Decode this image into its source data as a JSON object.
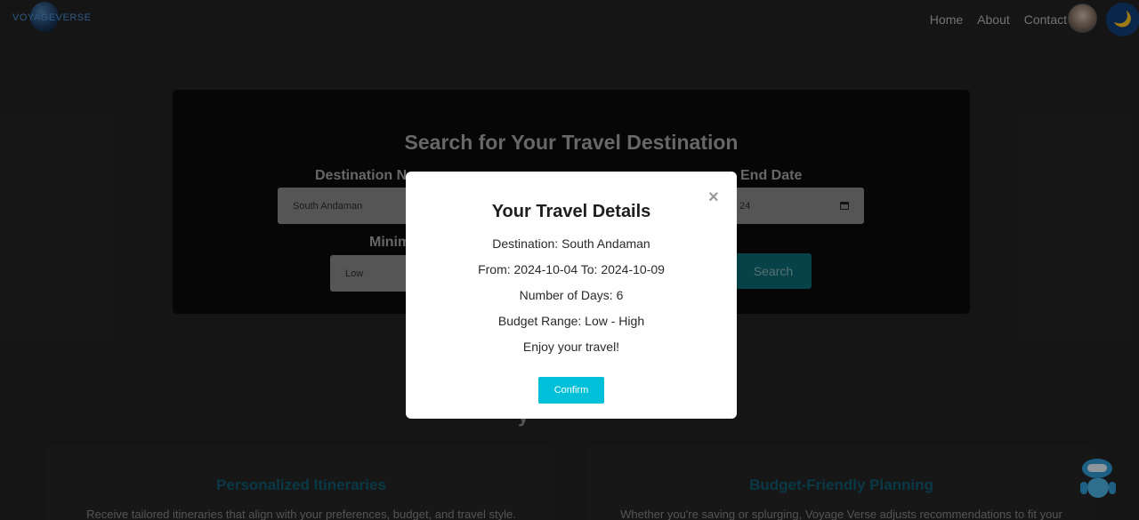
{
  "navbar": {
    "logo_text": "VOYAGEVERSE",
    "links": [
      "Home",
      "About",
      "Contact"
    ],
    "avatar_icon": "user-avatar",
    "theme_icon": "moon-icon",
    "theme_glyph": "🌙"
  },
  "search": {
    "title": "Search for Your Travel Destination",
    "destination_label": "Destination Na",
    "destination_value": "South Andaman",
    "end_date_label": "End Date",
    "end_date_value": "24",
    "min_label": "Minim",
    "min_value": "Low",
    "search_button": "Search"
  },
  "section": {
    "heading_fragment": "y"
  },
  "features": [
    {
      "title": "Personalized Itineraries",
      "desc": "Receive tailored itineraries that align with your preferences, budget, and travel style."
    },
    {
      "title": "Budget-Friendly Planning",
      "desc": "Whether you're saving or splurging, Voyage Verse adjusts recommendations to fit your"
    }
  ],
  "modal": {
    "close_glyph": "×",
    "title": "Your Travel Details",
    "destination_line": "Destination: South Andaman",
    "dates_line": "From: 2024-10-04 To: 2024-10-09",
    "days_line": "Number of Days: 6",
    "budget_line": "Budget Range: Low - High",
    "closing_line": "Enjoy your travel!",
    "confirm_button": "Confirm"
  },
  "colors": {
    "accent": "#00bfd8",
    "page_background": "#232323",
    "feature_title": "#105c73"
  }
}
